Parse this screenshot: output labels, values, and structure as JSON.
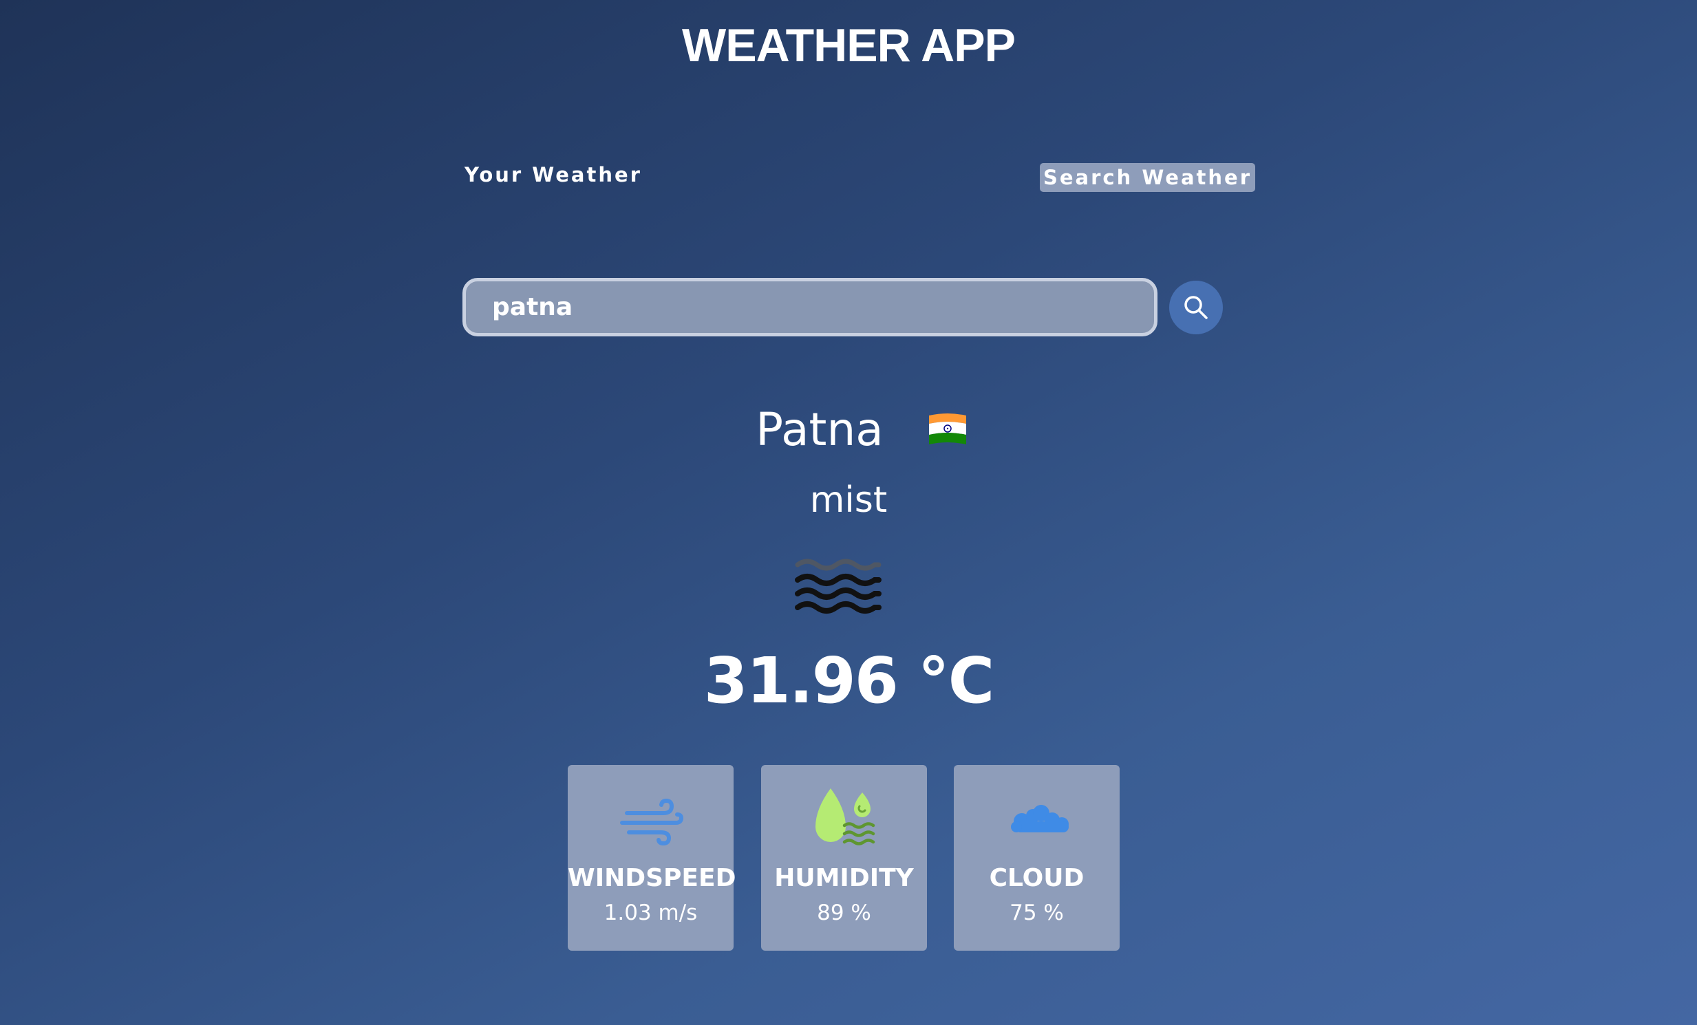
{
  "app": {
    "title": "WEATHER APP"
  },
  "tabs": {
    "your_weather": "Your Weather",
    "search_weather": "Search Weather",
    "active": "search_weather"
  },
  "search": {
    "value": "patna",
    "button_icon": "search-icon"
  },
  "current": {
    "city": "Patna",
    "country_flag": "india-flag-icon",
    "condition": "mist",
    "condition_icon": "mist-icon",
    "temperature": "31.96 °C"
  },
  "stats": [
    {
      "label": "WINDSPEED",
      "value": "1.03 m/s",
      "icon": "wind-icon"
    },
    {
      "label": "HUMIDITY",
      "value": "89 %",
      "icon": "humidity-icon"
    },
    {
      "label": "CLOUD",
      "value": "75 %",
      "icon": "cloud-icon"
    }
  ],
  "colors": {
    "background_start": "#1f3358",
    "background_end": "#4467a3",
    "card": "#8e9dba",
    "search_button": "#4770b2",
    "input": "#8897b2",
    "wind_icon": "#4d8ee0",
    "humidity_icon": "#b5eb73",
    "cloud_icon": "#3f8be6"
  }
}
